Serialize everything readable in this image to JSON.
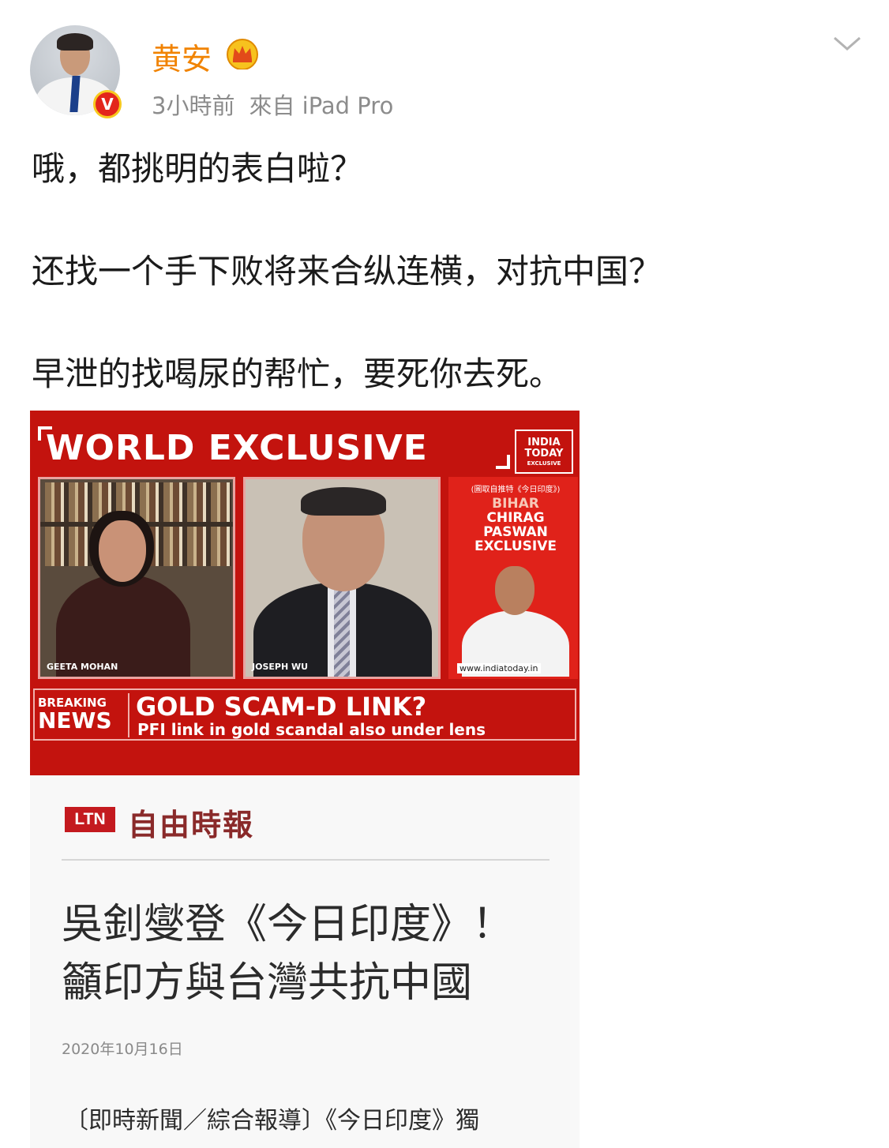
{
  "post": {
    "author": "黄安",
    "time": "3小時前",
    "source": "來自 iPad Pro",
    "lines": [
      "哦，都挑明的表白啦？",
      "还找一个手下败将来合纵连横，对抗中国？",
      "早泄的找喝尿的帮忙，要死你去死。"
    ]
  },
  "icons": {
    "crown": "crown-icon",
    "verified": "verified-v-icon",
    "menu": "chevron-down-icon"
  },
  "colors": {
    "username": "#f18300",
    "verified_badge": "#e3261b",
    "tv_red": "#c3130e",
    "ltn_red": "#c41a1f"
  },
  "news_image": {
    "banner": "WORLD EXCLUSIVE",
    "logo_line1": "INDIA",
    "logo_line2": "TODAY",
    "logo_small": "EXCLUSIVE",
    "panel1_caption": "GEETA MOHAN",
    "panel2_caption": "JOSEPH WU",
    "panel3_top": "(圖取自推特《今日印度》)",
    "panel3_l1": "BIHAR",
    "panel3_l2": "CHIRAG",
    "panel3_l3": "PASWAN",
    "panel3_l4": "EXCLUSIVE",
    "panel3_url": "www.indiatoday.in",
    "breaking_1": "BREAKING",
    "breaking_2": "NEWS",
    "headline": "GOLD SCAM-D LINK?",
    "subline": "PFI link in gold scandal also under lens"
  },
  "article": {
    "badge": "LTN",
    "paper_name": "自由時報",
    "title_line1": "吳釗燮登《今日印度》！",
    "title_line2": "籲印方與台灣共抗中國",
    "date": "2020年10月16日",
    "lead": "〔即時新聞／綜合報導〕《今日印度》獨"
  }
}
